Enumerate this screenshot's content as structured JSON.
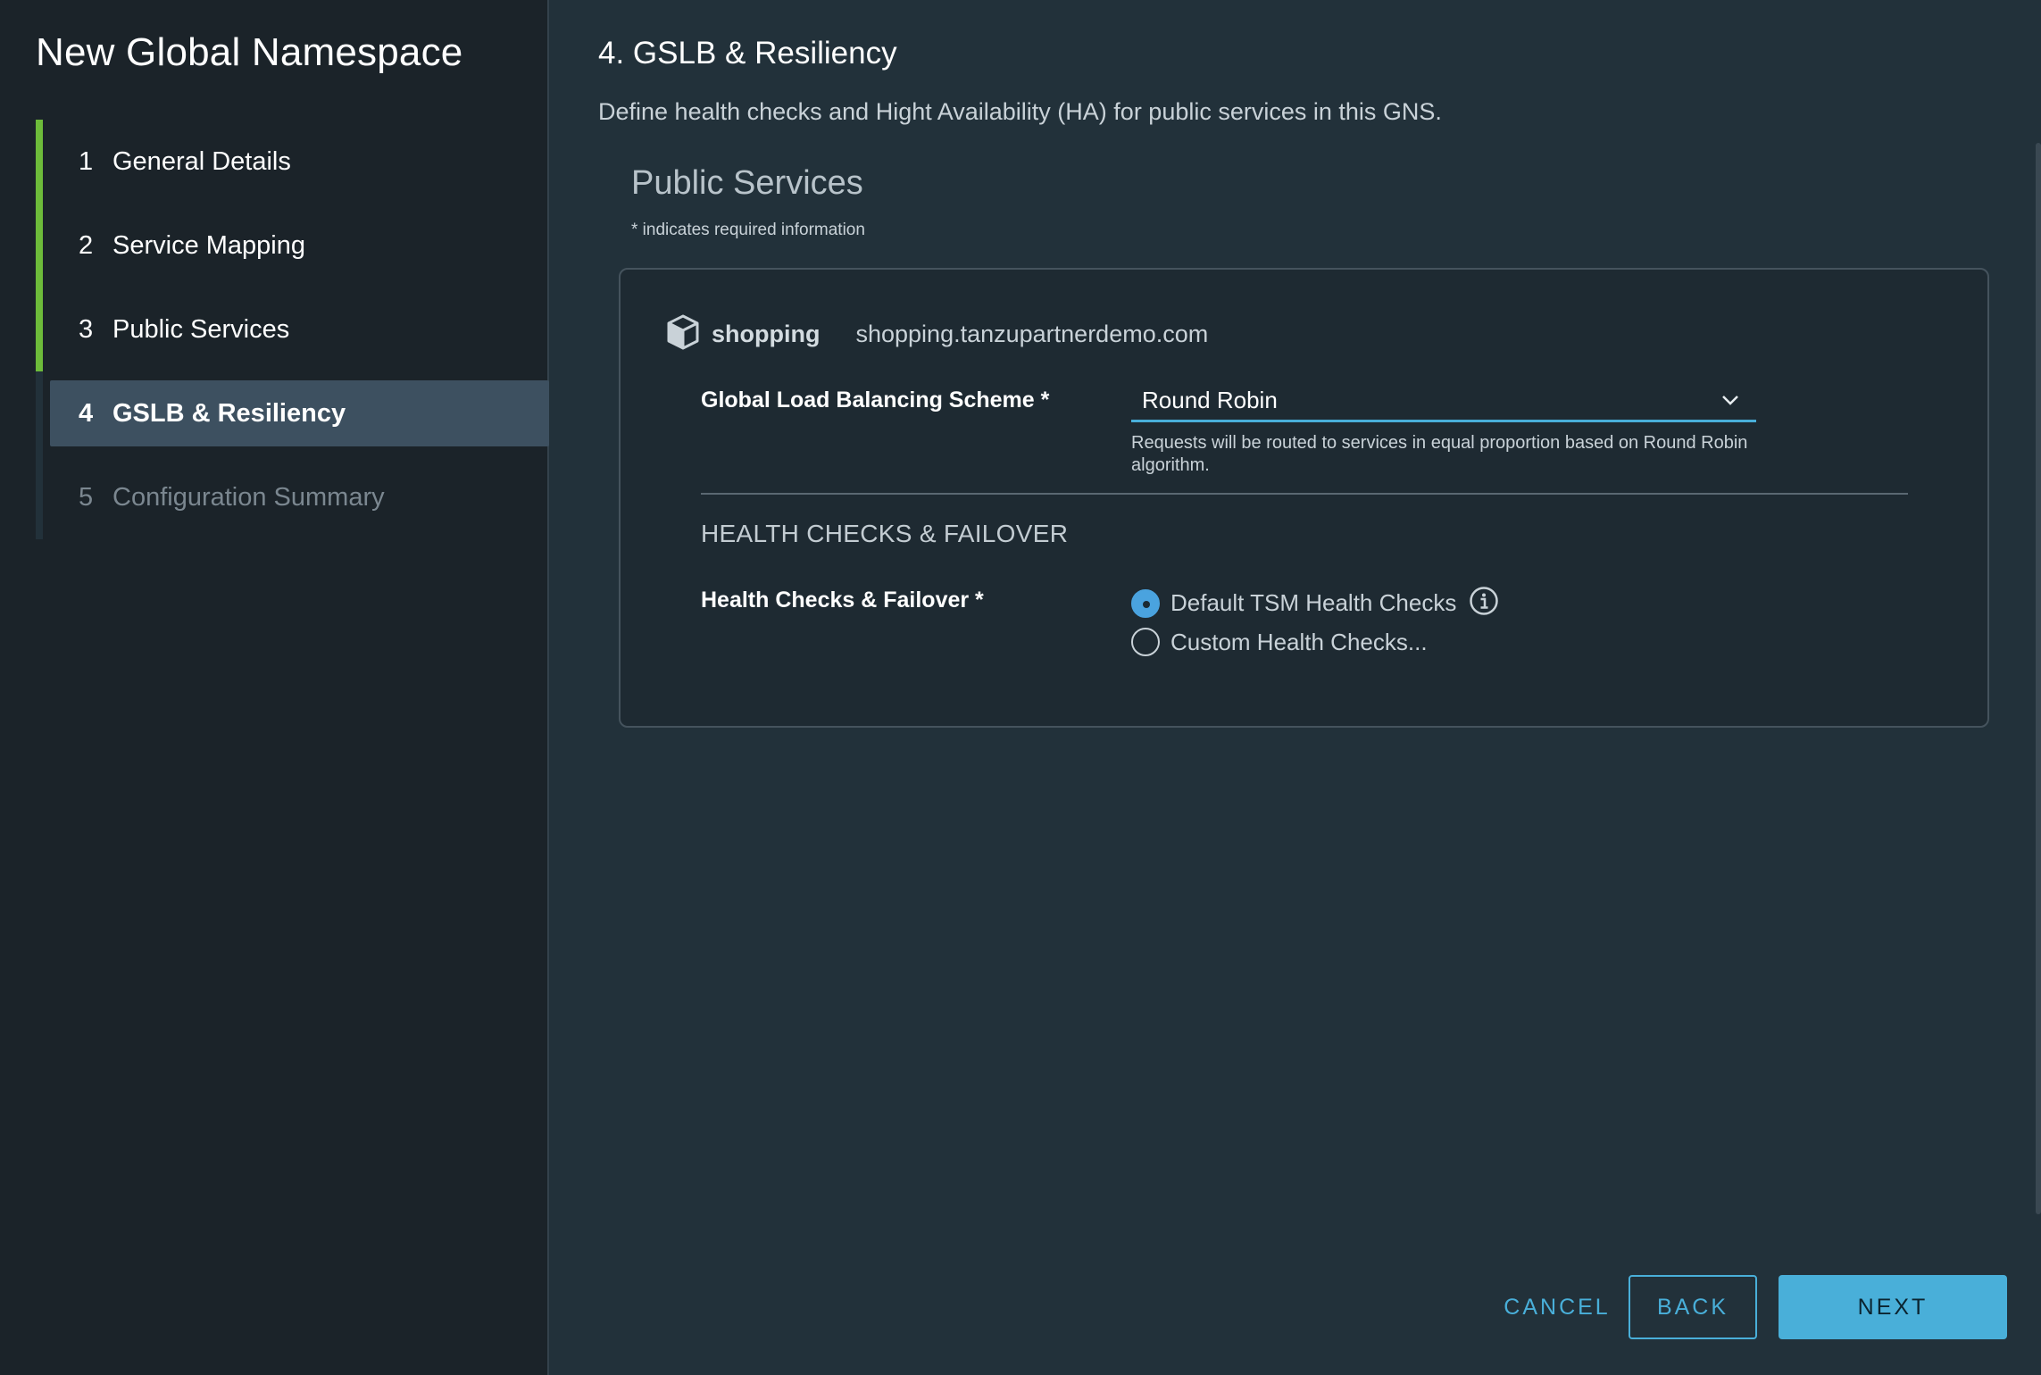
{
  "wizard": {
    "title": "New Global Namespace",
    "steps": [
      {
        "num": "1",
        "label": "General Details",
        "state": "complete"
      },
      {
        "num": "2",
        "label": "Service Mapping",
        "state": "complete"
      },
      {
        "num": "3",
        "label": "Public Services",
        "state": "complete"
      },
      {
        "num": "4",
        "label": "GSLB & Resiliency",
        "state": "active"
      },
      {
        "num": "5",
        "label": "Configuration Summary",
        "state": "disabled"
      }
    ]
  },
  "page": {
    "title": "4. GSLB & Resiliency",
    "description": "Define health checks and Hight Availability (HA) for public services in this GNS.",
    "section_title": "Public Services",
    "required_note": "* indicates required information"
  },
  "service": {
    "icon": "cube-icon",
    "name": "shopping",
    "host": "shopping.tanzupartnerdemo.com",
    "lb_label": "Global Load Balancing Scheme *",
    "lb_value": "Round Robin",
    "lb_helper": "Requests will be routed to services in equal proportion based on Round Robin algorithm.",
    "health_heading": "HEALTH CHECKS & FAILOVER",
    "health_label": "Health Checks & Failover *",
    "options": [
      {
        "label": "Default TSM Health Checks",
        "checked": true
      },
      {
        "label": "Custom Health Checks...",
        "checked": false
      }
    ]
  },
  "footer": {
    "cancel": "CANCEL",
    "back": "BACK",
    "next": "NEXT"
  },
  "colors": {
    "accent": "#49afd9",
    "complete_bar": "#6dbb3a",
    "sidebar_bg": "#1b2329",
    "main_bg": "#22313a"
  }
}
